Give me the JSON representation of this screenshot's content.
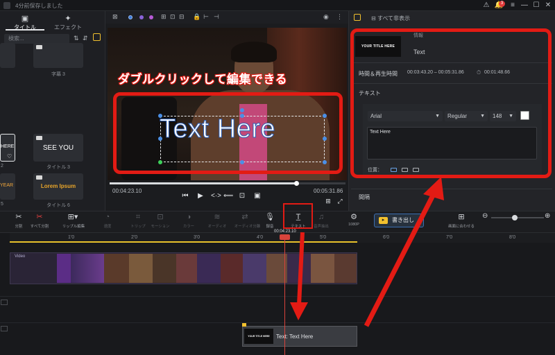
{
  "titlebar": {
    "status": "4分前保存しました",
    "notification_count": "3"
  },
  "left_panel": {
    "tabs": [
      {
        "label": "タイトル",
        "icon": "title-icon"
      },
      {
        "label": "エフェクト",
        "icon": "effect-icon"
      }
    ],
    "search_placeholder": "検索...",
    "tiles": [
      {
        "label": "字幕 3",
        "text": ""
      },
      {
        "label": "タイトル 3",
        "text": "SEE YOU"
      },
      {
        "label": "タイトル 6",
        "text": "Lorem Ipsum"
      },
      {
        "label": "2",
        "text": "HERE"
      },
      {
        "label": "5",
        "text": "YEAR"
      }
    ]
  },
  "preview": {
    "current_time": "00:04:23.10",
    "total_time": "00:05:31.86",
    "progress": 0.79,
    "overlay_text": "Text Here"
  },
  "right_panel": {
    "show_all": "すべて非表示",
    "info_label": "情報",
    "thumbnail_text": "YOUR TITLE HERE",
    "name": "Text",
    "time_label": "時間＆再生時間",
    "time_range": "00:03:43.20 – 00:05:31.86",
    "duration": "00:01:48.66",
    "section_text": "テキスト",
    "font": "Arial",
    "weight": "Regular",
    "size": "148",
    "text_value": "Text Here",
    "position_label": "位置：",
    "spacing_label": "間隔"
  },
  "toolbar": {
    "tools": [
      {
        "label": "分割",
        "icon": "scissors-icon"
      },
      {
        "label": "すべて分割",
        "icon": "split-all-icon"
      },
      {
        "label": "リップル編集",
        "icon": "ripple-edit-icon"
      },
      {
        "label": "速度",
        "icon": "speed-icon"
      },
      {
        "label": "トリップ",
        "icon": "crop-icon"
      },
      {
        "label": "モーション",
        "icon": "motion-icon"
      },
      {
        "label": "カラー",
        "icon": "color-icon"
      },
      {
        "label": "オーディオ",
        "icon": "audio-icon"
      },
      {
        "label": "オーディオ分離",
        "icon": "audio-separate-icon"
      },
      {
        "label": "録音",
        "icon": "mic-icon"
      },
      {
        "label": "テキスト",
        "icon": "text-icon"
      },
      {
        "label": "音声抽出",
        "icon": "extract-icon"
      },
      {
        "label": "1080P",
        "icon": "resolution-icon"
      }
    ],
    "export_label": "書き出し",
    "fit_label": "画面に合わせる"
  },
  "timeline": {
    "ticks": [
      "1'0",
      "2'0",
      "3'0",
      "4'0",
      "5'0",
      "6'0",
      "7'0",
      "8'0"
    ],
    "playhead_time": "00:04:23.10",
    "video_track_label": "Video",
    "text_clip_label": "Text: Text Here",
    "text_clip_thumb": "YOUR TITLE HERE"
  },
  "annotation": {
    "caption": "ダブルクリックして編集できる"
  },
  "colors": {
    "annotation_red": "#e31b14",
    "accent_blue": "#3b6fb3",
    "export_yellow": "#f2c12e",
    "playhead_red": "#d9433b"
  }
}
